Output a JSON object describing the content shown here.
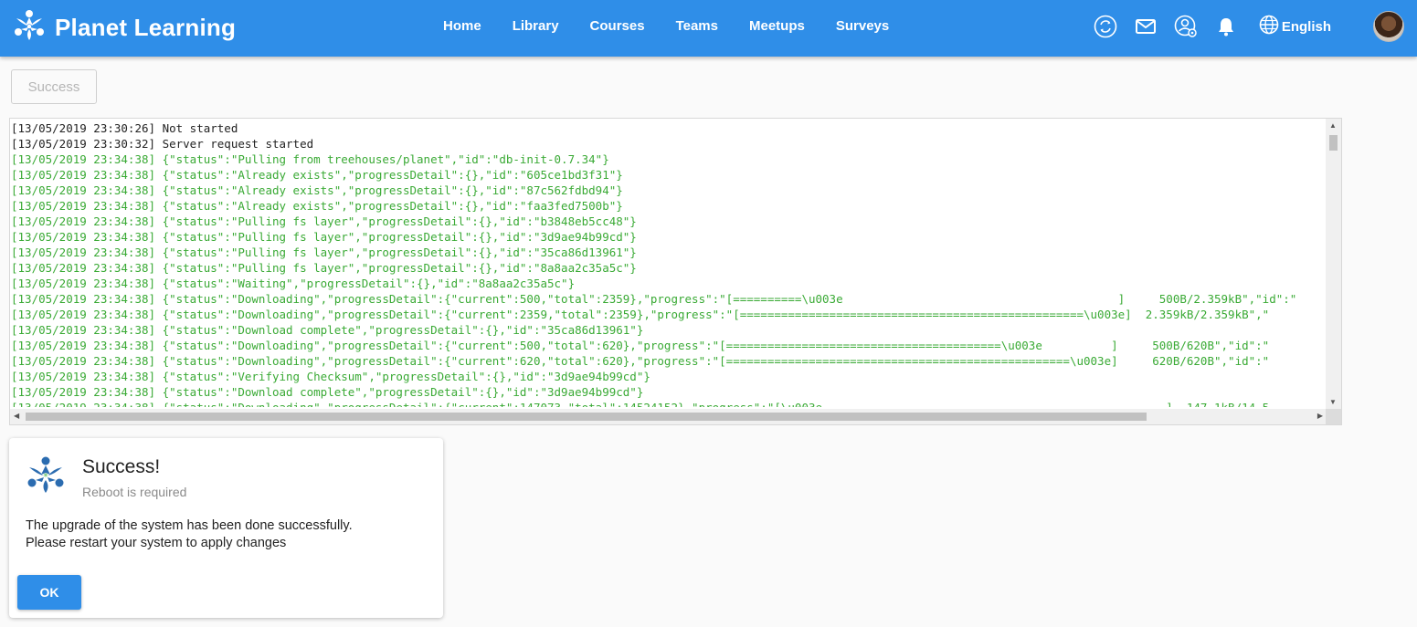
{
  "app": {
    "title": "Planet Learning",
    "brand_color": "#2f8ee8"
  },
  "nav": {
    "items": [
      "Home",
      "Library",
      "Courses",
      "Teams",
      "Meetups",
      "Surveys"
    ]
  },
  "header_icons": [
    "sync-icon",
    "mail-icon",
    "user-settings-icon",
    "bell-icon",
    "globe-icon"
  ],
  "language": {
    "label": "English"
  },
  "status_button": {
    "label": "Success"
  },
  "log": {
    "lines": [
      {
        "text": "[13/05/2019 23:30:26] Not started",
        "type": "plain"
      },
      {
        "text": "[13/05/2019 23:30:32] Server request started",
        "type": "plain"
      },
      {
        "text": "[13/05/2019 23:34:38] {\"status\":\"Pulling from treehouses/planet\",\"id\":\"db-init-0.7.34\"}",
        "type": "green"
      },
      {
        "text": "[13/05/2019 23:34:38] {\"status\":\"Already exists\",\"progressDetail\":{},\"id\":\"605ce1bd3f31\"}",
        "type": "green"
      },
      {
        "text": "[13/05/2019 23:34:38] {\"status\":\"Already exists\",\"progressDetail\":{},\"id\":\"87c562fdbd94\"}",
        "type": "green"
      },
      {
        "text": "[13/05/2019 23:34:38] {\"status\":\"Already exists\",\"progressDetail\":{},\"id\":\"faa3fed7500b\"}",
        "type": "green"
      },
      {
        "text": "[13/05/2019 23:34:38] {\"status\":\"Pulling fs layer\",\"progressDetail\":{},\"id\":\"b3848eb5cc48\"}",
        "type": "green"
      },
      {
        "text": "[13/05/2019 23:34:38] {\"status\":\"Pulling fs layer\",\"progressDetail\":{},\"id\":\"3d9ae94b99cd\"}",
        "type": "green"
      },
      {
        "text": "[13/05/2019 23:34:38] {\"status\":\"Pulling fs layer\",\"progressDetail\":{},\"id\":\"35ca86d13961\"}",
        "type": "green"
      },
      {
        "text": "[13/05/2019 23:34:38] {\"status\":\"Pulling fs layer\",\"progressDetail\":{},\"id\":\"8a8aa2c35a5c\"}",
        "type": "green"
      },
      {
        "text": "[13/05/2019 23:34:38] {\"status\":\"Waiting\",\"progressDetail\":{},\"id\":\"8a8aa2c35a5c\"}",
        "type": "green"
      },
      {
        "text": "[13/05/2019 23:34:38] {\"status\":\"Downloading\",\"progressDetail\":{\"current\":500,\"total\":2359},\"progress\":\"[==========\\u003e                                        ]     500B/2.359kB\",\"id\":\"",
        "type": "green"
      },
      {
        "text": "[13/05/2019 23:34:38] {\"status\":\"Downloading\",\"progressDetail\":{\"current\":2359,\"total\":2359},\"progress\":\"[==================================================\\u003e]  2.359kB/2.359kB\",\"",
        "type": "green"
      },
      {
        "text": "[13/05/2019 23:34:38] {\"status\":\"Download complete\",\"progressDetail\":{},\"id\":\"35ca86d13961\"}",
        "type": "green"
      },
      {
        "text": "[13/05/2019 23:34:38] {\"status\":\"Downloading\",\"progressDetail\":{\"current\":500,\"total\":620},\"progress\":\"[========================================\\u003e          ]     500B/620B\",\"id\":\"",
        "type": "green"
      },
      {
        "text": "[13/05/2019 23:34:38] {\"status\":\"Downloading\",\"progressDetail\":{\"current\":620,\"total\":620},\"progress\":\"[==================================================\\u003e]     620B/620B\",\"id\":\"",
        "type": "green"
      },
      {
        "text": "[13/05/2019 23:34:38] {\"status\":\"Verifying Checksum\",\"progressDetail\":{},\"id\":\"3d9ae94b99cd\"}",
        "type": "green"
      },
      {
        "text": "[13/05/2019 23:34:38] {\"status\":\"Download complete\",\"progressDetail\":{},\"id\":\"3d9ae94b99cd\"}",
        "type": "green"
      },
      {
        "text": "[13/05/2019 23:34:38] {\"status\":\"Downloading\",\"progressDetail\":{\"current\":147073,\"total\":14524152},\"progress\":\"[\\u003e                                                  ]  147.1kB/14.5",
        "type": "green"
      }
    ]
  },
  "dialog": {
    "title": "Success!",
    "subtitle": "Reboot is required",
    "body_line1": "The upgrade of the system has been done successfully.",
    "body_line2": "Please restart your system to apply changes",
    "ok_label": "OK"
  }
}
